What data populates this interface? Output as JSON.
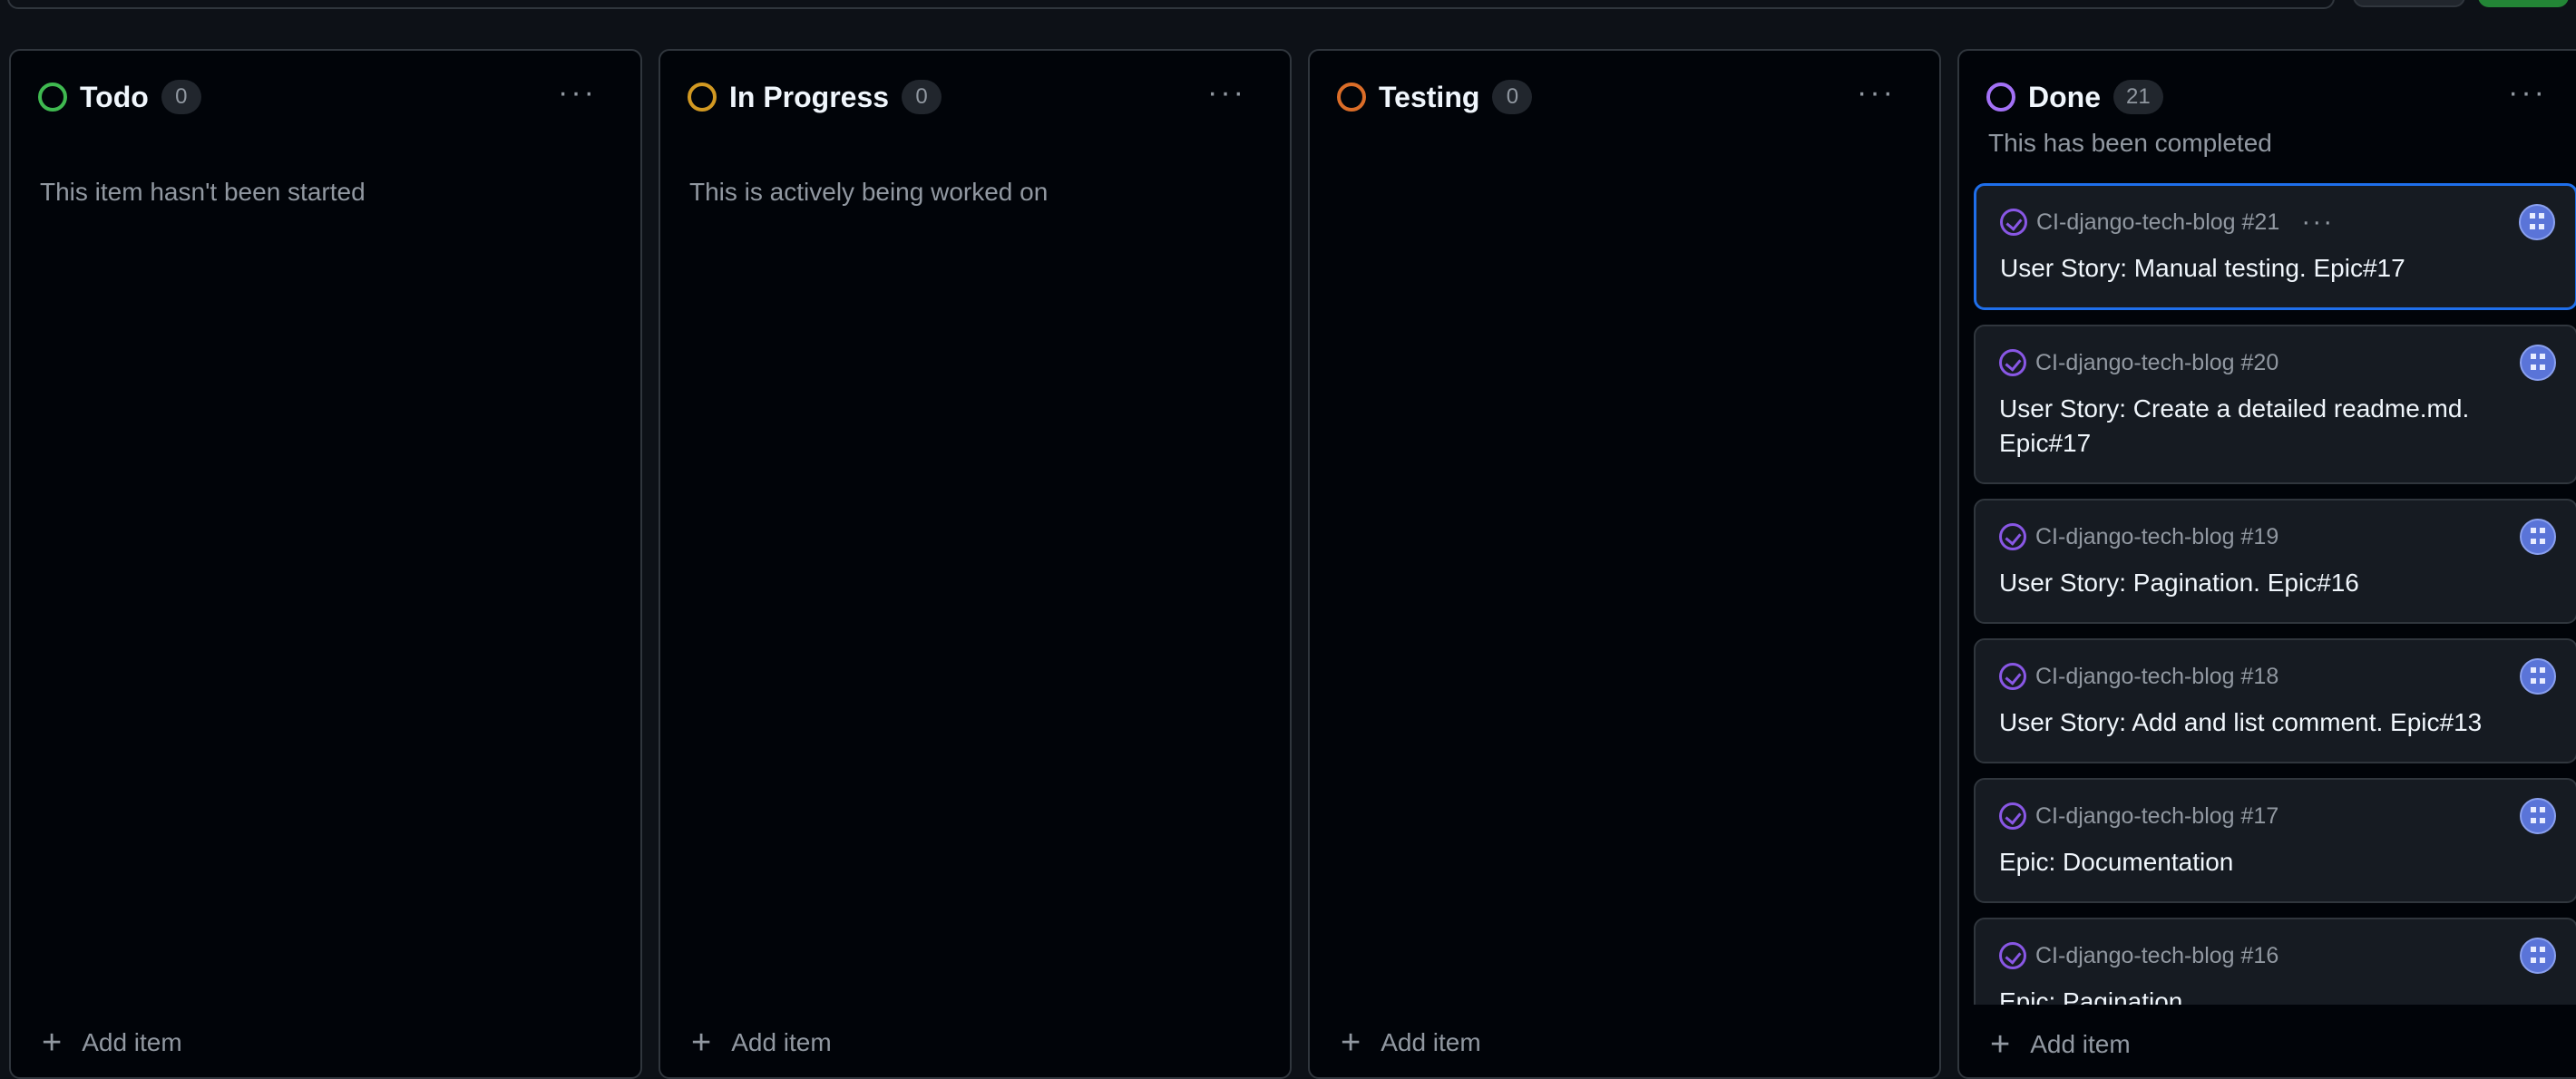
{
  "columns": [
    {
      "title": "Todo",
      "count": "0",
      "description": "This item hasn't been started",
      "color": "#3fb950",
      "add_label": "Add item"
    },
    {
      "title": "In Progress",
      "count": "0",
      "description": "This is actively being worked on",
      "color": "#d29922",
      "add_label": "Add item"
    },
    {
      "title": "Testing",
      "count": "0",
      "description": "",
      "color": "#db6d28",
      "add_label": "Add item"
    },
    {
      "title": "Done",
      "count": "21",
      "description": "This has been completed",
      "color": "#a371f7",
      "add_label": "Add item"
    }
  ],
  "done_cards": [
    {
      "repo": "CI-django-tech-blog #21",
      "title": "User Story: Manual testing. Epic#17"
    },
    {
      "repo": "CI-django-tech-blog #20",
      "title": "User Story: Create a detailed readme.md. Epic#17"
    },
    {
      "repo": "CI-django-tech-blog #19",
      "title": "User Story: Pagination. Epic#16"
    },
    {
      "repo": "CI-django-tech-blog #18",
      "title": "User Story: Add and list comment. Epic#13"
    },
    {
      "repo": "CI-django-tech-blog #17",
      "title": "Epic: Documentation"
    },
    {
      "repo": "CI-django-tech-blog #16",
      "title": "Epic: Pagination"
    }
  ],
  "icons": {
    "status": "status-circle-icon",
    "menu": "ellipsis-icon",
    "add": "plus-icon",
    "closed_issue": "check-circle-icon",
    "assignee": "avatar"
  }
}
